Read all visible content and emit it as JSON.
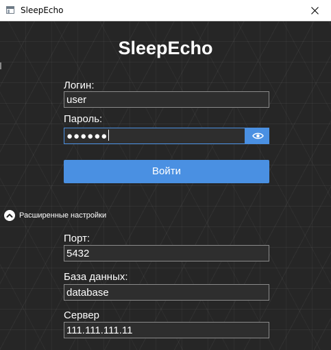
{
  "window": {
    "title": "SleepEcho",
    "close_icon": "close-icon",
    "app_icon": "window-icon"
  },
  "main": {
    "heading": "SleepEcho"
  },
  "login_form": {
    "login_label": "Логин:",
    "login_value": "user",
    "password_label": "Пароль:",
    "password_masked": "●●●●●●",
    "show_password_icon": "eye-icon",
    "submit_label": "Войти"
  },
  "advanced": {
    "toggle_label": "Расширенные настройки",
    "toggle_icon": "chevron-up-icon",
    "port_label": "Порт:",
    "port_value": "5432",
    "database_label": "База данных:",
    "database_value": "database",
    "server_label": "Сервер",
    "server_value": "111.111.111.11"
  },
  "colors": {
    "accent": "#4a90e2",
    "background": "#262626",
    "field_background": "#2e2e2e"
  }
}
